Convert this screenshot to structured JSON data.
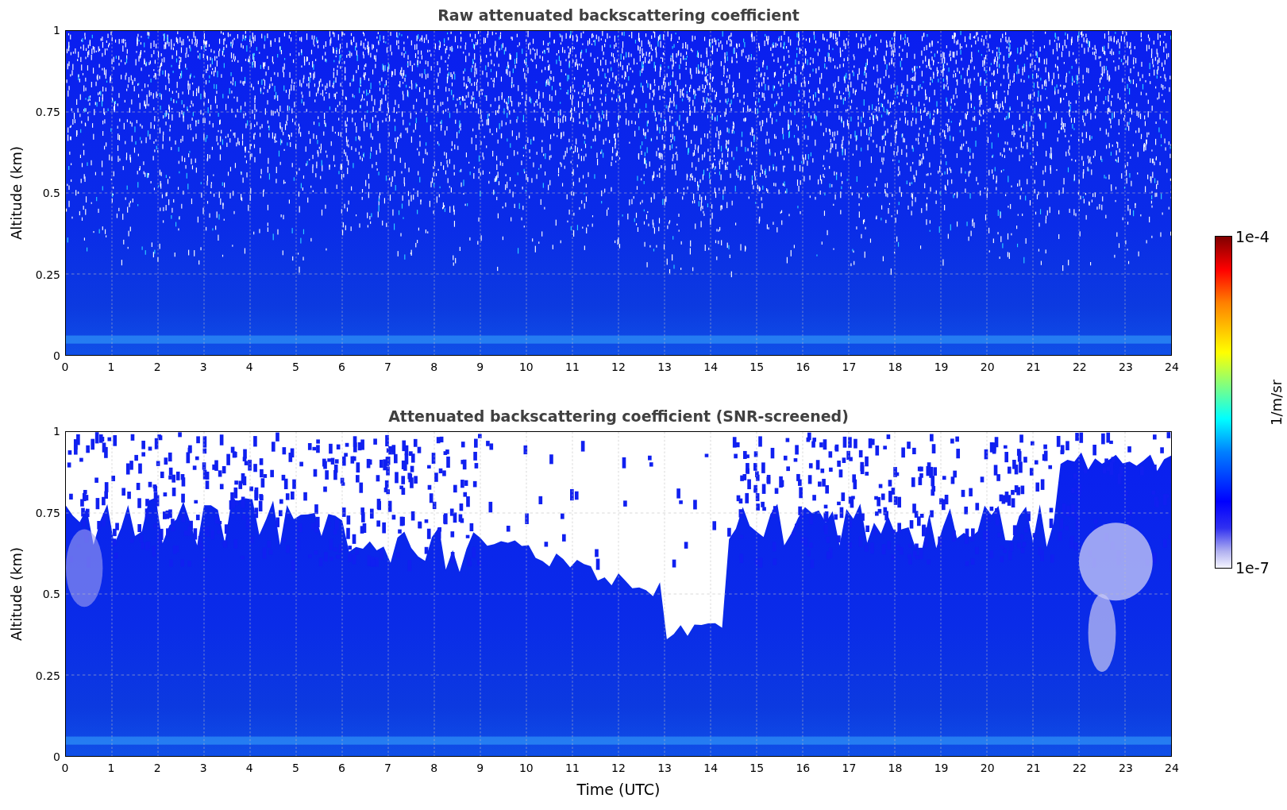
{
  "panels": [
    {
      "kind": "raw",
      "title": "Raw attenuated backscattering coefficient",
      "ylabel": "Altitude (km)",
      "yticks": [
        "1",
        "0.75",
        "0.5",
        "0.25",
        "0"
      ],
      "xticks": [
        "0",
        "1",
        "2",
        "3",
        "4",
        "5",
        "6",
        "7",
        "8",
        "9",
        "10",
        "11",
        "12",
        "13",
        "14",
        "15",
        "16",
        "17",
        "18",
        "19",
        "20",
        "21",
        "22",
        "23",
        "24"
      ]
    },
    {
      "kind": "screened",
      "title": "Attenuated backscattering coefficient (SNR-screened)",
      "ylabel": "Altitude (km)",
      "yticks": [
        "1",
        "0.75",
        "0.5",
        "0.25",
        "0"
      ],
      "xticks": [
        "0",
        "1",
        "2",
        "3",
        "4",
        "5",
        "6",
        "7",
        "8",
        "9",
        "10",
        "11",
        "12",
        "13",
        "14",
        "15",
        "16",
        "17",
        "18",
        "19",
        "20",
        "21",
        "22",
        "23",
        "24"
      ]
    }
  ],
  "xlabel": "Time (UTC)",
  "colorbar": {
    "max_label": "1e-4",
    "min_label": "1e-7",
    "label": "1/m/sr"
  }
}
